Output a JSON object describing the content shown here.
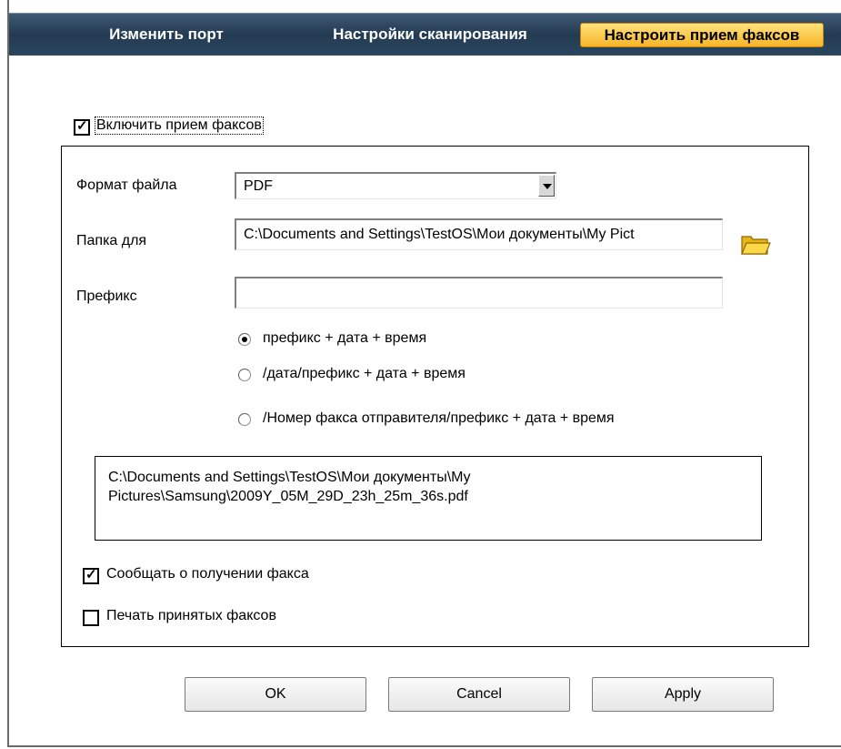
{
  "tabs": [
    {
      "label": "Изменить порт",
      "active": false
    },
    {
      "label": "Настройки сканирования",
      "active": false
    },
    {
      "label": "Настроить прием факсов",
      "active": true
    }
  ],
  "enable_fax": {
    "label": "Включить прием факсов",
    "checked": true
  },
  "form": {
    "file_format_label": "Формат файла",
    "file_format_value": "PDF",
    "folder_label": "Папка для",
    "folder_value": "C:\\Documents and Settings\\TestOS\\Мои документы\\My Pict",
    "prefix_label": "Префикс",
    "prefix_value": ""
  },
  "naming_options": [
    {
      "label": "префикс + дата + время",
      "selected": true
    },
    {
      "label": "/дата/префикс + дата + время",
      "selected": false
    },
    {
      "label": "/Номер факса отправителя/префикс + дата + время",
      "selected": false
    }
  ],
  "preview": {
    "line1": "C:\\Documents and Settings\\TestOS\\Мои документы\\My",
    "line2": "Pictures\\Samsung\\2009Y_05M_29D_23h_25m_36s.pdf"
  },
  "notify": {
    "label": "Сообщать о получении факса",
    "checked": true
  },
  "print_received": {
    "label": "Печать принятых факсов",
    "checked": false
  },
  "buttons": {
    "ok": "OK",
    "cancel": "Cancel",
    "apply": "Apply"
  },
  "icons": {
    "folder": "folder-icon"
  },
  "colors": {
    "active_tab": "#f7b529",
    "topbar": "#233b52"
  }
}
